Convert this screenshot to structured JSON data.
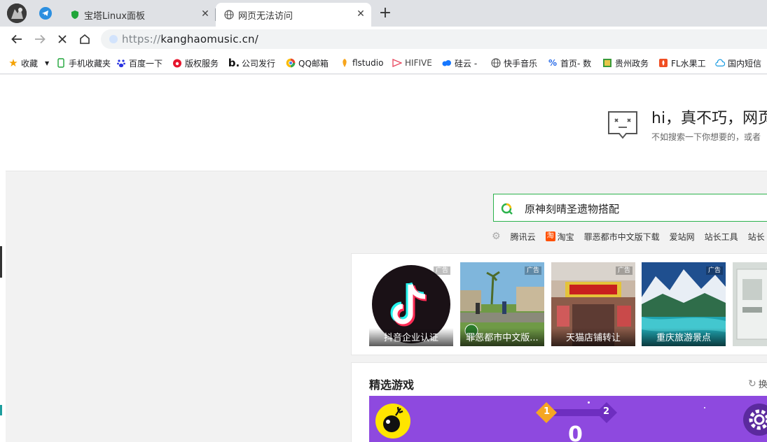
{
  "browser": {
    "tabs": [
      {
        "label": "宝塔Linux面板",
        "icon": "shield-icon"
      },
      {
        "label": "网页无法访问",
        "icon": "globe-icon"
      }
    ],
    "url": {
      "protocol": "https://",
      "host": "kanghaomusic.cn/"
    }
  },
  "bookmarks": [
    {
      "label": "收藏",
      "icon": "star-icon"
    },
    {
      "label": "手机收藏夹",
      "icon": "phone-icon"
    },
    {
      "label": "百度一下",
      "icon": "baidu-icon"
    },
    {
      "label": "版权服务",
      "icon": "weibo-icon"
    },
    {
      "label": "公司发行",
      "icon": "b-logo-icon"
    },
    {
      "label": "QQ邮箱",
      "icon": "qqmail-icon"
    },
    {
      "label": "flstudio",
      "icon": "fl-icon"
    },
    {
      "label": "HIFIVE",
      "icon": "hifive-icon"
    },
    {
      "label": "硅云 -",
      "icon": "cloud-dot-icon"
    },
    {
      "label": "快手音乐",
      "icon": "globe-icon"
    },
    {
      "label": "首页- 数",
      "icon": "logo-icon"
    },
    {
      "label": "贵州政务",
      "icon": "gov-icon"
    },
    {
      "label": "FL水果工",
      "icon": "fl-red-icon"
    },
    {
      "label": "国内短信",
      "icon": "cloud-icon"
    }
  ],
  "error": {
    "title": "hi，真不巧，网页",
    "subtitle": "不如搜索一下你想要的，或者"
  },
  "search": {
    "value": "原神刻晴圣遗物搭配"
  },
  "hotlinks": [
    "腾讯云",
    "淘宝",
    "罪恶都市中文版下载",
    "爱站网",
    "站长工具",
    "站长"
  ],
  "ads": {
    "badge": "广告",
    "cards": [
      "抖音企业认证",
      "罪恶都市中文版...",
      "天猫店铺转让",
      "重庆旅游景点"
    ]
  },
  "games": {
    "title": "精选游戏",
    "refresh": "换",
    "level_start": "1",
    "level_end": "2",
    "score": "0"
  }
}
